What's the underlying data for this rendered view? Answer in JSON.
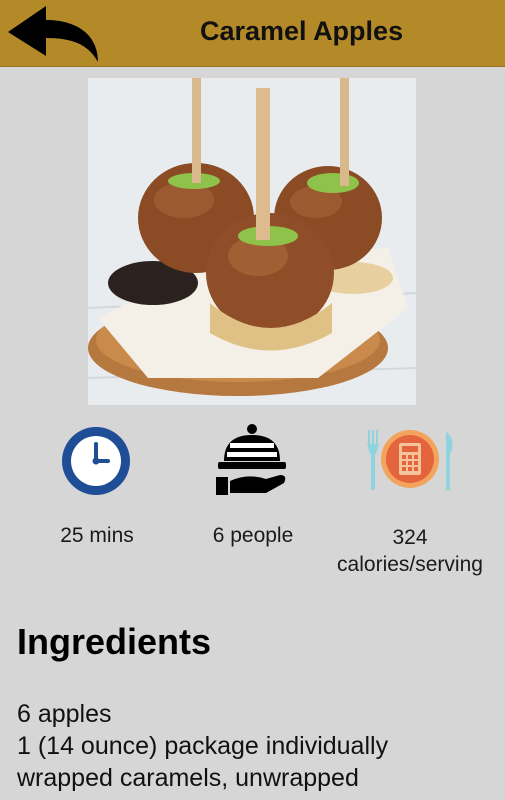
{
  "header": {
    "title": "Caramel Apples",
    "back_icon": "back-arrow-icon",
    "background": "#b48a28"
  },
  "hero": {
    "icon": "caramel-apples-photo"
  },
  "stats": [
    {
      "icon": "clock-icon",
      "label": "25 mins"
    },
    {
      "icon": "serving-cloche-icon",
      "label": "6 people"
    },
    {
      "icon": "calculator-plate-icon",
      "label_line1": "324",
      "label_line2": "calories/serving"
    }
  ],
  "ingredients": {
    "title": "Ingredients",
    "items": [
      "6 apples",
      "1 (14 ounce) package individually",
      "wrapped caramels, unwrapped"
    ]
  }
}
